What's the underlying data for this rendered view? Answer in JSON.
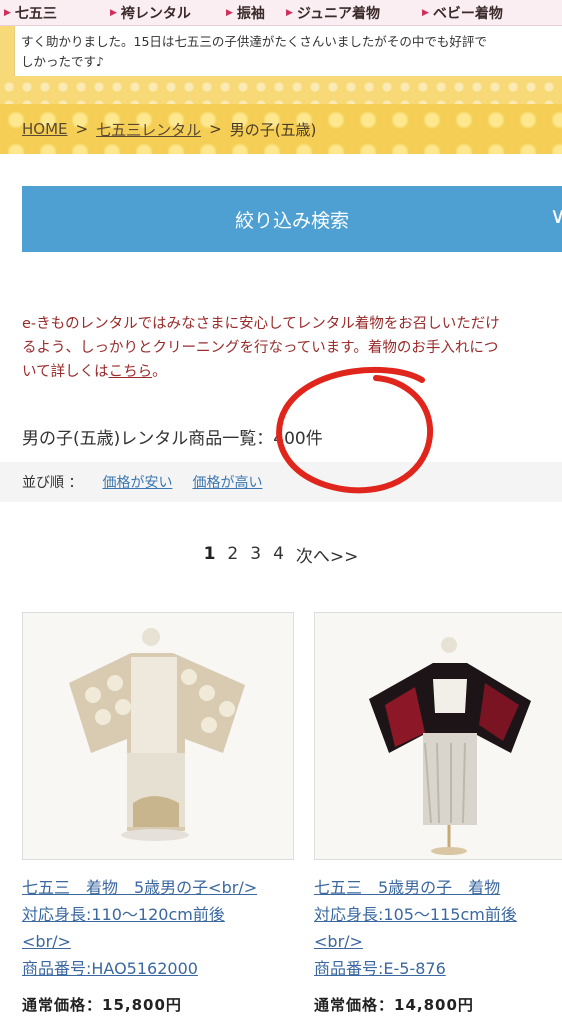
{
  "nav": {
    "items": [
      "七五三",
      "袴レンタル",
      "振袖",
      "ジュニア着物",
      "ベビー着物"
    ]
  },
  "review": {
    "line1": "すく助かりました。15日は七五三の子供達がたくさんいましたがその中でも好評で",
    "line2": "しかったです♪"
  },
  "breadcrumb": {
    "home": "HOME",
    "sep1": ">",
    "category": "七五三レンタル",
    "sep2": ">",
    "current": "男の子(五歳)"
  },
  "search": {
    "label": "絞り込み検索",
    "chevron": "∨"
  },
  "notice": {
    "line1": "e-きものレンタルではみなさまに安心してレンタル着物をお召しいただけ",
    "line2": "るよう、しっかりとクリーニングを行なっています。着物のお手入れにつ",
    "line3_prefix": "いて詳しくは",
    "link": "こちら",
    "line3_suffix": "。"
  },
  "count": {
    "text": "男の子(五歳)レンタル商品一覧：400件"
  },
  "sort": {
    "label": "並び順 ：",
    "options": [
      "価格が安い",
      "価格が高い"
    ]
  },
  "pagination": {
    "pages": [
      "1",
      "2",
      "3",
      "4"
    ],
    "next": "次へ>>"
  },
  "products": [
    {
      "title_lines": [
        "七五三　着物　5歳男の子<br/>",
        "対応身長:110〜120cm前後",
        "<br/>",
        "商品番号:HAO5162000"
      ],
      "price": "通常価格：15,800円"
    },
    {
      "title_lines": [
        "七五三　5歳男の子　着物",
        "対応身長:105〜115cm前後",
        "<br/>",
        "商品番号:E-5-876"
      ],
      "price": "通常価格：14,800円"
    }
  ],
  "colors": {
    "accent_blue": "#4fa0d2",
    "notice_red": "#9a2b2b",
    "annotation_red": "#e0261c",
    "breadcrumb_yellow": "#f5cf55"
  }
}
